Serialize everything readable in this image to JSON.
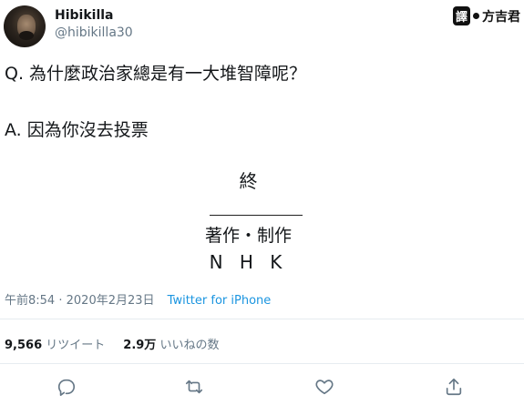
{
  "author": {
    "display_name": "Hibikilla",
    "handle": "@hibikilla30"
  },
  "watermark": {
    "box_text": "譯",
    "name": "方吉君"
  },
  "tweet": {
    "question": "Q. 為什麼政治家總是有一大堆智障呢？",
    "answer": "A. 因為你沒去投票",
    "end_mark": "終",
    "credit": "著作・制作",
    "network": "N H K"
  },
  "meta": {
    "time": "午前8:54",
    "sep": "·",
    "date": "2020年2月23日",
    "source": "Twitter for iPhone"
  },
  "stats": {
    "retweets_count": "9,566",
    "retweets_label": "リツイート",
    "likes_count": "2.9万",
    "likes_label": "いいねの数"
  },
  "icons": {
    "reply": "reply-icon",
    "retweet": "retweet-icon",
    "like": "heart-icon",
    "share": "share-icon"
  }
}
